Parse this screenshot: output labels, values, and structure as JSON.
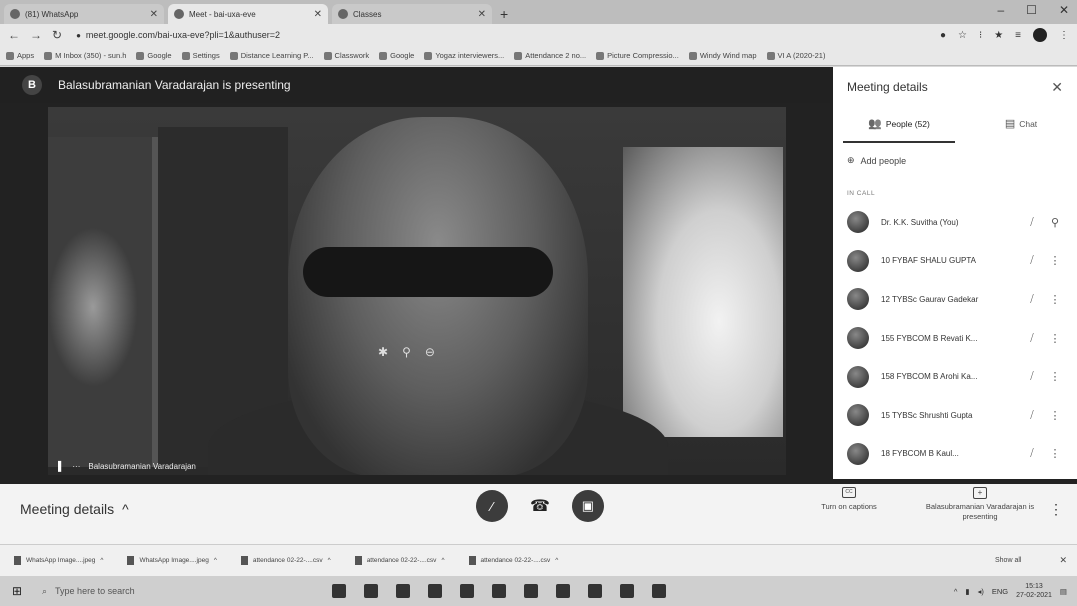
{
  "browser": {
    "tabs": [
      {
        "label": "(81) WhatsApp",
        "active": false
      },
      {
        "label": "Meet - bai-uxa-eve",
        "active": true
      },
      {
        "label": "Classes",
        "active": false
      }
    ],
    "url": "meet.google.com/bai-uxa-eve?pli=1&authuser=2",
    "bookmarks": [
      "Apps",
      "M Inbox (350) - sun.h",
      "Google",
      "Settings",
      "Distance Learning P...",
      "Classwork",
      "Google",
      "Yogaz interviewers...",
      "Attendance 2 no...",
      "Picture Compressio...",
      "Windy Wind map",
      "VI A (2020-21)"
    ]
  },
  "meet": {
    "presenting_banner": "Balasubramanian Varadarajan is presenting",
    "presenter_initial": "B",
    "tile_name": "Balasubramanian Varadarajan",
    "meeting_details_label": "Meeting details",
    "captions_label": "Turn on captions",
    "presenting_label": "Balasubramanian Varadarajan is presenting"
  },
  "panel": {
    "title": "Meeting details",
    "people_tab": "People (52)",
    "chat_tab": "Chat",
    "add_people": "Add people",
    "in_call": "IN CALL",
    "participants": [
      "Dr. K.K. Suvitha (You)",
      "10 FYBAF SHALU GUPTA",
      "12 TYBSc Gaurav Gadekar",
      "155 FYBCOM B Revati K...",
      "158 FYBCOM B Arohi Ka...",
      "15 TYBSc Shrushti Gupta",
      "18 FYBCOM B Kaul..."
    ]
  },
  "downloads": {
    "items": [
      "WhatsApp Image....jpeg",
      "WhatsApp Image....jpeg",
      "attendance 02-22-....csv",
      "attendance 02-22-....csv",
      "attendance 02-22-....csv"
    ],
    "show_all": "Show all"
  },
  "taskbar": {
    "search_placeholder": "Type here to search",
    "lang": "ENG",
    "time": "15:13",
    "date": "27-02-2021"
  }
}
